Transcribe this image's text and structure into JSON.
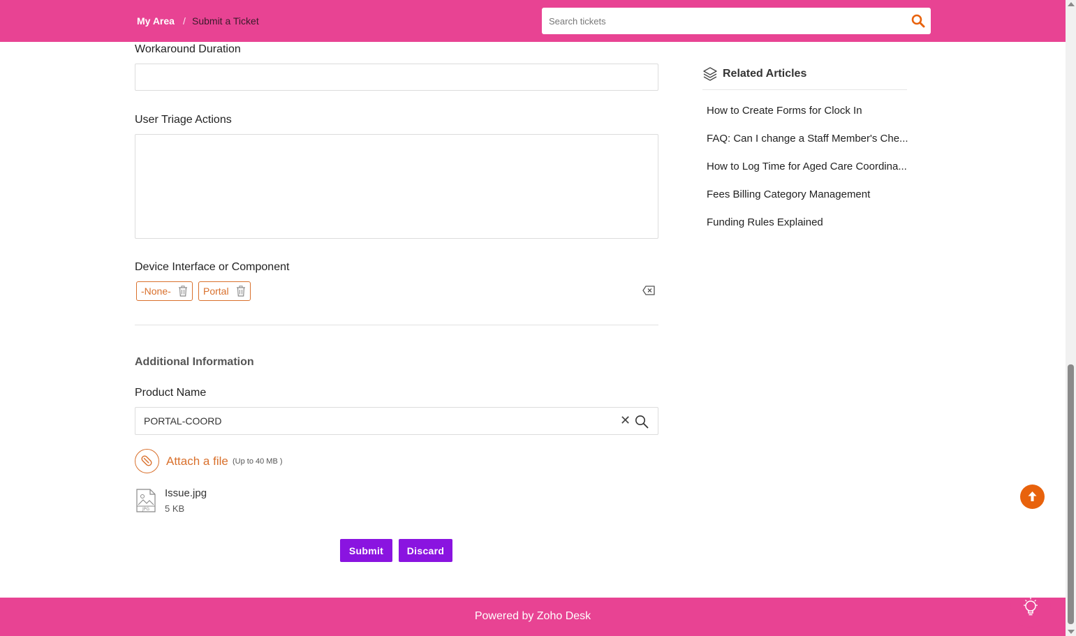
{
  "header": {
    "breadcrumb_home": "My Area",
    "breadcrumb_separator": "/",
    "breadcrumb_current": "Submit a Ticket",
    "search_placeholder": "Search tickets",
    "search_icon": "search-icon"
  },
  "form": {
    "workaround_duration": {
      "label": "Workaround Duration",
      "value": ""
    },
    "user_triage_actions": {
      "label": "User Triage Actions",
      "value": ""
    },
    "device_interface": {
      "label": "Device Interface or Component",
      "tags": [
        {
          "label": "-None-"
        },
        {
          "label": "Portal"
        }
      ]
    },
    "additional_info_title": "Additional Information",
    "product_name": {
      "label": "Product Name",
      "value": "PORTAL-COORD",
      "clear_glyph": "✕"
    },
    "attachment": {
      "label": "Attach a file",
      "limit": "(Up to 40 MB )",
      "file_name": "Issue.jpg",
      "file_size": "5 KB",
      "file_type": "JPG"
    },
    "submit_label": "Submit",
    "discard_label": "Discard"
  },
  "related": {
    "title": "Related Articles",
    "articles": [
      "How to Create Forms for Clock In",
      "FAQ: Can I change a Staff Member's Che...",
      "How to Log Time for Aged Care Coordina...",
      "Fees Billing Category Management",
      "Funding Rules Explained"
    ]
  },
  "footer": {
    "text": "Powered by Zoho Desk"
  },
  "colors": {
    "brand_pink": "#e84393",
    "accent_orange": "#d9702c",
    "button_purple": "#8a14e0",
    "scroll_top_orange": "#e8620c"
  }
}
